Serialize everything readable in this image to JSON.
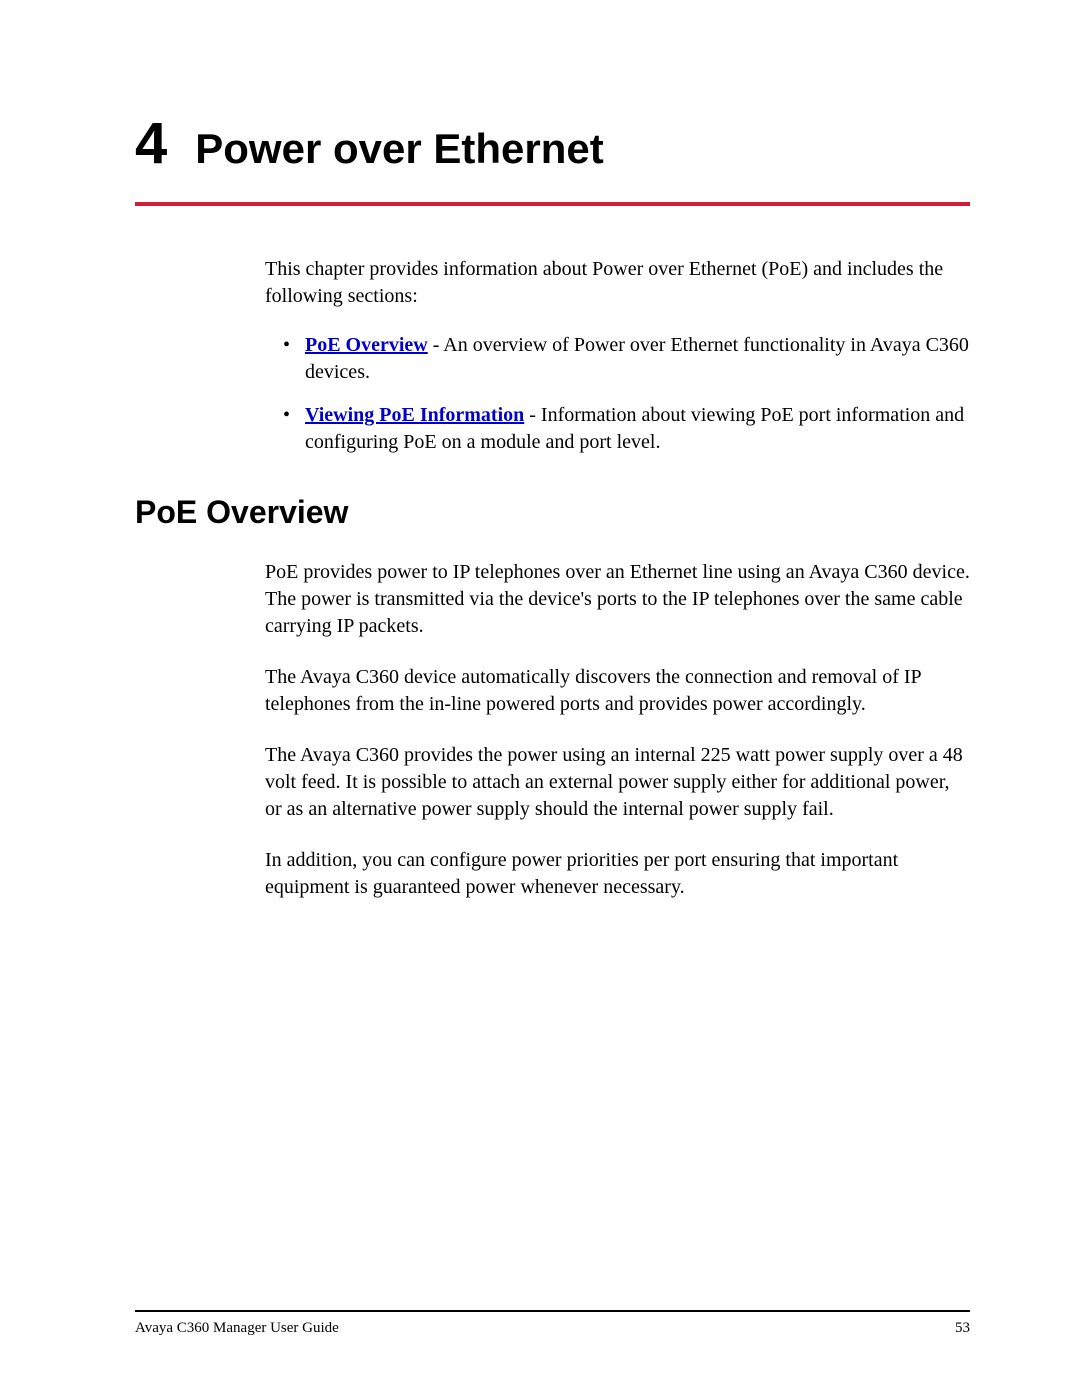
{
  "chapter": {
    "number": "4",
    "title": "Power over Ethernet"
  },
  "intro": "This chapter provides information about Power over Ethernet (PoE) and includes the following sections:",
  "bullets": [
    {
      "link": "PoE Overview",
      "rest": " - An overview of Power over Ethernet functionality in Avaya C360 devices."
    },
    {
      "link": "Viewing PoE Information",
      "rest": " - Information about viewing PoE port information and configuring PoE on a module and port level."
    }
  ],
  "section": {
    "heading": "PoE Overview",
    "paragraphs": [
      "PoE provides power to IP telephones over an Ethernet line using an Avaya C360 device. The power is transmitted via the device's ports to the IP telephones over the same cable carrying IP packets.",
      "The Avaya C360 device automatically discovers the connection and removal of IP telephones from the in-line powered ports and provides power accordingly.",
      "The Avaya C360 provides the power using an internal 225 watt power supply over a 48 volt feed. It is possible to attach an external power supply either for additional power, or as an alternative power supply should the internal power supply fail.",
      "In addition, you can configure power priorities per port ensuring that important equipment is guaranteed power whenever necessary."
    ]
  },
  "footer": {
    "left": "Avaya C360 Manager User Guide",
    "right": "53"
  }
}
